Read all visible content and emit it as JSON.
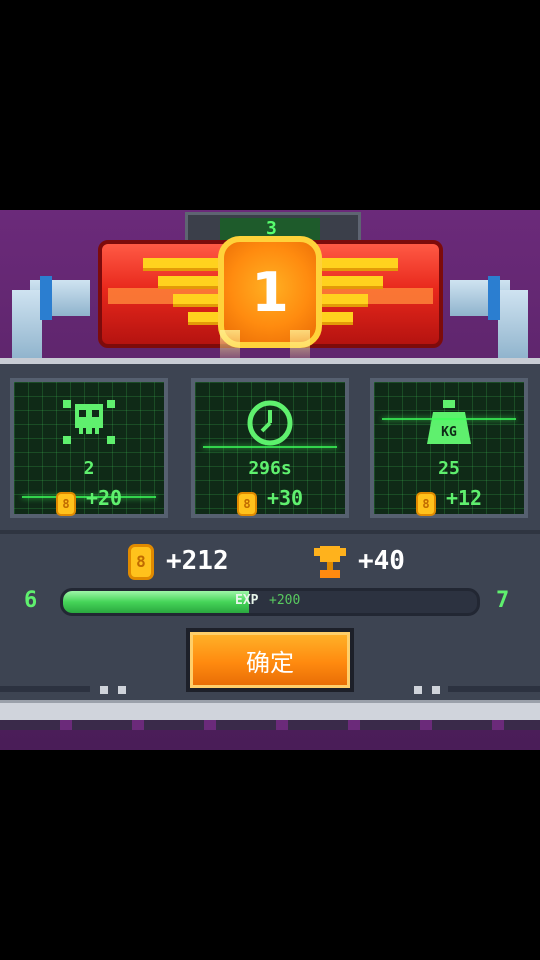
{
  "top_screen_digit": "3",
  "rank": "1",
  "stats": [
    {
      "icon": "skull-crossbones-icon",
      "value": "2",
      "reward": "+20"
    },
    {
      "icon": "clock-icon",
      "value": "296s",
      "reward": "+30"
    },
    {
      "icon": "weight-kg-icon",
      "value": "25",
      "reward": "+12",
      "icon_text": "KG"
    }
  ],
  "summary": {
    "coins": "+212",
    "trophies": "+40"
  },
  "level": {
    "current": "6",
    "next": "7",
    "progress": 0.45,
    "exp_label": "EXP",
    "exp_gain": "+200"
  },
  "coin_symbol": "8",
  "confirm_label": "确定",
  "colors": {
    "accent_green": "#5ff06e",
    "button_orange": "#ff8a0f",
    "coin_gold": "#ffc21c",
    "background_purple": "#6b2a7a"
  }
}
